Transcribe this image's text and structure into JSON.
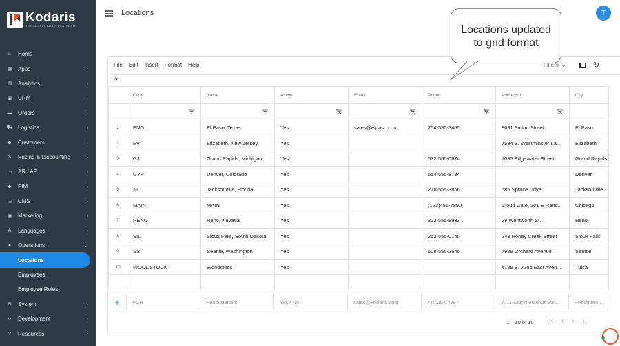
{
  "brand": {
    "name": "Kodaris",
    "tagline": "THE SUPPLY CHAIN PLATFORM"
  },
  "sidebar": {
    "items": [
      {
        "label": "Home",
        "icon": "home-icon",
        "glyph": "⌂",
        "chevron": ""
      },
      {
        "label": "Apps",
        "icon": "apps-icon",
        "glyph": "▦",
        "chevron": "›"
      },
      {
        "label": "Analytics",
        "icon": "analytics-icon",
        "glyph": "▤",
        "chevron": "›"
      },
      {
        "label": "CRM",
        "icon": "crm-icon",
        "glyph": "▣",
        "chevron": "›"
      },
      {
        "label": "Orders",
        "icon": "orders-icon",
        "glyph": "▬",
        "chevron": "›"
      },
      {
        "label": "Logistics",
        "icon": "logistics-icon",
        "glyph": "⛟",
        "chevron": "›"
      },
      {
        "label": "Customers",
        "icon": "customers-icon",
        "glyph": "☻",
        "chevron": "›"
      },
      {
        "label": "Pricing & Discounting",
        "icon": "pricing-icon",
        "glyph": "$",
        "chevron": "›"
      },
      {
        "label": "AR / AP",
        "icon": "ar-ap-icon",
        "glyph": "▭",
        "chevron": "›"
      },
      {
        "label": "PIM",
        "icon": "pim-icon",
        "glyph": "◆",
        "chevron": "›"
      },
      {
        "label": "CMS",
        "icon": "cms-icon",
        "glyph": "▭",
        "chevron": "›"
      },
      {
        "label": "Marketing",
        "icon": "marketing-icon",
        "glyph": "▣",
        "chevron": "›"
      },
      {
        "label": "Languages",
        "icon": "languages-icon",
        "glyph": "A",
        "chevron": "›"
      },
      {
        "label": "Operations",
        "icon": "operations-icon",
        "glyph": "●",
        "chevron": "⌄"
      }
    ],
    "subitems": [
      {
        "label": "Locations",
        "active": true
      },
      {
        "label": "Employees",
        "active": false
      },
      {
        "label": "Employee Roles",
        "active": false
      }
    ],
    "bottom_items": [
      {
        "label": "System",
        "icon": "system-icon",
        "glyph": "⚙",
        "chevron": "›"
      },
      {
        "label": "Development",
        "icon": "development-icon",
        "glyph": "‹›",
        "chevron": "›"
      },
      {
        "label": "Resources",
        "icon": "resources-icon",
        "glyph": "?",
        "chevron": "›"
      }
    ]
  },
  "header": {
    "title": "Locations",
    "avatar_initial": "T"
  },
  "callout": {
    "line1": "Locations updated",
    "line2": "to grid format"
  },
  "toolbar": {
    "menus": [
      "File",
      "Edit",
      "Insert",
      "Format",
      "Help"
    ],
    "filters_label": "Filters",
    "filters_chevron": "⌄",
    "fx_label": "fx"
  },
  "grid": {
    "columns": [
      "Code",
      "Name",
      "Active",
      "Email",
      "Phone",
      "Address 1",
      "City"
    ],
    "sort_indicator": "↑",
    "rows": [
      {
        "n": "1",
        "code": "ENG",
        "name": "El Paso, Texas",
        "active": "Yes",
        "email": "sales@elpaso.com",
        "phone": "754-555-3465",
        "address": "9691 Fulton Street",
        "city": "El Paso"
      },
      {
        "n": "2",
        "code": "EV",
        "name": "Elizabeth, New Jersey",
        "active": "Yes",
        "email": "",
        "phone": "",
        "address": "7534 S. Westminster La...",
        "city": "Elizabeth"
      },
      {
        "n": "3",
        "code": "GJ",
        "name": "Grand Rapids, Michigan",
        "active": "Yes",
        "email": "",
        "phone": "632-555-0674",
        "address": "7095 Edgewater Street",
        "city": "Grand Rapids"
      },
      {
        "n": "4",
        "code": "GYP",
        "name": "Denver, Colorado",
        "active": "Yes",
        "email": "",
        "phone": "654-555-8734",
        "address": "",
        "city": "Denver"
      },
      {
        "n": "5",
        "code": "JT",
        "name": "Jacksonville, Florida",
        "active": "Yes",
        "email": "",
        "phone": "278-555-3856",
        "address": "586 Spruce Drive",
        "city": "Jacksonville"
      },
      {
        "n": "6",
        "code": "MAIN",
        "name": "MAIN",
        "active": "Yes",
        "email": "",
        "phone": "(123)456-7890",
        "address": "Cloud Gate, 201 E Rand...",
        "city": "Chicago"
      },
      {
        "n": "7",
        "code": "RENO",
        "name": "Reno, Nevada",
        "active": "Yes",
        "email": "",
        "phone": "323-555-8933",
        "address": "29 Wentworth St.",
        "city": "Reno"
      },
      {
        "n": "8",
        "code": "SIL",
        "name": "Sioux Falls, South Dakota",
        "active": "Yes",
        "email": "",
        "phone": "253-555-0145",
        "address": "243 Honey Creek Street",
        "city": "Sioux Falls"
      },
      {
        "n": "9",
        "code": "SS",
        "name": "Seattle, Washington",
        "active": "Yes",
        "email": "",
        "phone": "608-555-2645",
        "address": "7999 Orchard Avenue",
        "city": "Seattle"
      },
      {
        "n": "10",
        "code": "WOODSTOCK",
        "name": "Woodstock",
        "active": "Yes",
        "email": "",
        "phone": "",
        "address": "4129 S. 72nd East Aven...",
        "city": "Tulsa"
      }
    ],
    "new_row": {
      "plus": "+",
      "code": "PCH",
      "name": "Headquarters",
      "active": "Yes / No",
      "email": "sales@kodaris.com",
      "phone": "470.264.4997",
      "address": "2011 Commerce Dr Suit...",
      "city": "Peachtree City"
    }
  },
  "pagination": {
    "range": "1 – 10 of 10",
    "first": "|‹",
    "prev": "‹",
    "next": "›",
    "last": "›|"
  }
}
